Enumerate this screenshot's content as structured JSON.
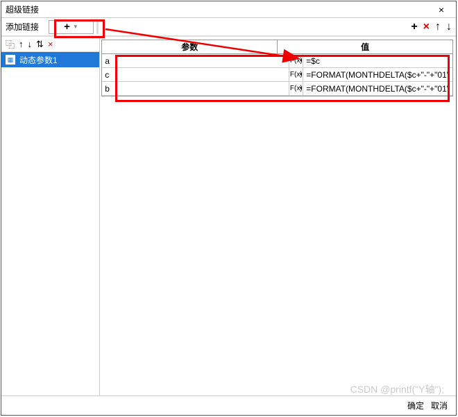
{
  "window": {
    "title": "超级链接"
  },
  "toolbar": {
    "label": "添加链接",
    "add_plus": "+",
    "right_icons": {
      "plus": "+",
      "x": "×",
      "up": "↑",
      "down": "↓"
    }
  },
  "left_pane": {
    "icons": {
      "copy": "⿻",
      "up": "↑",
      "down": "↓",
      "sort": "⇅",
      "x": "×"
    },
    "items": [
      {
        "label": "动态参数1"
      }
    ]
  },
  "table": {
    "headers": {
      "param": "参数",
      "value": "值"
    },
    "fx_label": "F(x)",
    "rows": [
      {
        "param": "a",
        "value": "=$c"
      },
      {
        "param": "c",
        "value": "=FORMAT(MONTHDELTA($c+\"-\"+\"01\""
      },
      {
        "param": "b",
        "value": "=FORMAT(MONTHDELTA($c+\"-\"+\"01\""
      }
    ]
  },
  "footer": {
    "ok": "确定",
    "cancel": "取消"
  },
  "watermark": "CSDN @printf(\"Y轴\");"
}
